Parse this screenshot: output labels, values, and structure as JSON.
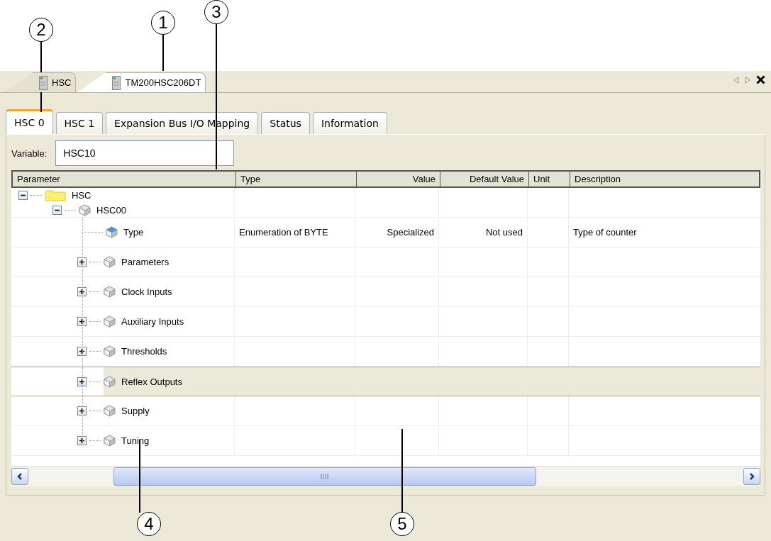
{
  "callouts": [
    {
      "label": "2"
    },
    {
      "label": "1"
    },
    {
      "label": "3"
    },
    {
      "label": "4"
    },
    {
      "label": "5"
    }
  ],
  "editor_tabs": [
    {
      "label": "HSC",
      "selected": false
    },
    {
      "label": "TM200HSC206DT",
      "selected": true
    }
  ],
  "tabs": [
    {
      "label": "HSC 0",
      "selected": true
    },
    {
      "label": "HSC 1",
      "selected": false
    },
    {
      "label": "Expansion Bus I/O Mapping",
      "selected": false
    },
    {
      "label": "Status",
      "selected": false
    },
    {
      "label": "Information",
      "selected": false
    }
  ],
  "variable": {
    "label": "Variable:",
    "value": "HSC10"
  },
  "table": {
    "columns": [
      "Parameter",
      "Type",
      "Value",
      "Default Value",
      "Unit",
      "Description"
    ],
    "tree": [
      {
        "label": "HSC",
        "kind": "folder",
        "expanded": true,
        "selected": false,
        "children": [
          {
            "label": "HSC00",
            "kind": "object",
            "expanded": true,
            "selected": false,
            "children": [
              {
                "label": "Type",
                "kind": "field",
                "selected": false,
                "cells": {
                  "type": "Enumeration of BYTE",
                  "value": "Specialized",
                  "default_value": "Not used",
                  "description": "Type of counter"
                }
              },
              {
                "label": "Parameters",
                "kind": "object",
                "expanded": false,
                "selected": false
              },
              {
                "label": "Clock Inputs",
                "kind": "object",
                "expanded": false,
                "selected": false
              },
              {
                "label": "Auxiliary Inputs",
                "kind": "object",
                "expanded": false,
                "selected": false
              },
              {
                "label": "Thresholds",
                "kind": "object",
                "expanded": false,
                "selected": false
              },
              {
                "label": "Reflex Outputs",
                "kind": "object",
                "expanded": false,
                "selected": true
              },
              {
                "label": "Supply",
                "kind": "object",
                "expanded": false,
                "selected": false
              },
              {
                "label": "Tuning",
                "kind": "object",
                "expanded": false,
                "selected": false
              }
            ]
          }
        ]
      }
    ]
  }
}
